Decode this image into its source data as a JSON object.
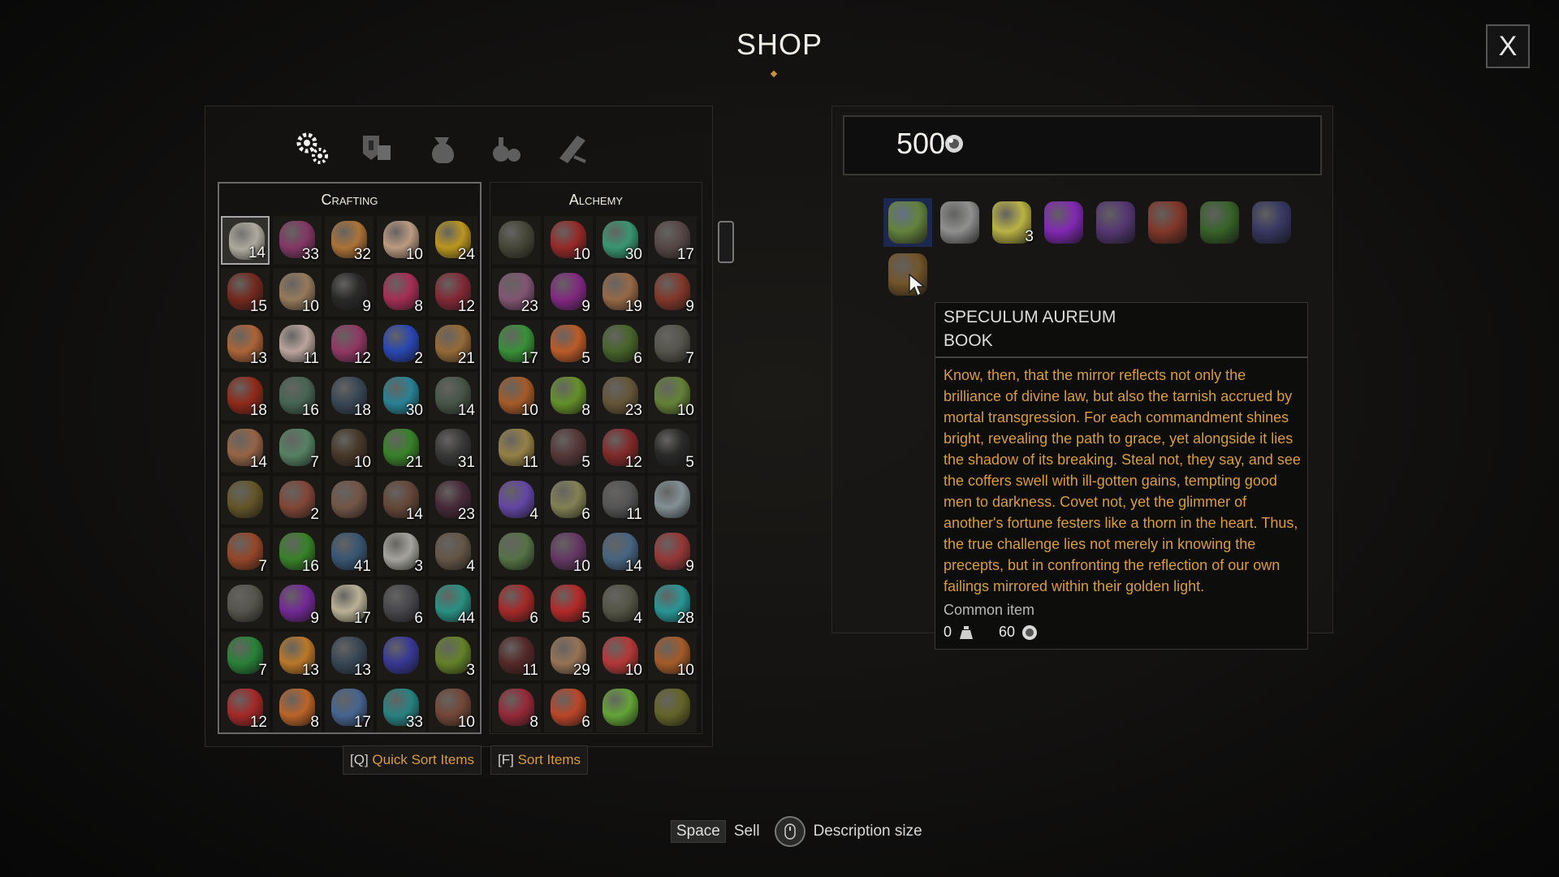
{
  "title": "SHOP",
  "close_label": "X",
  "tabs": [
    {
      "icon": "gears-icon",
      "active": true
    },
    {
      "icon": "armor-icon",
      "active": false
    },
    {
      "icon": "sack-icon",
      "active": false
    },
    {
      "icon": "potion-bottles-icon",
      "active": false
    },
    {
      "icon": "quest-scroll-icon",
      "active": false
    }
  ],
  "crafting": {
    "label": "Crafting",
    "items": [
      {
        "icon": "jar-icon",
        "qty": "14",
        "color": "#b8b4a8",
        "selected": true
      },
      {
        "icon": "fungus-icon",
        "qty": "33",
        "color": "#8a3a6a"
      },
      {
        "icon": "bark-icon",
        "qty": "32",
        "color": "#b87a3a"
      },
      {
        "icon": "vial-icon",
        "qty": "10",
        "color": "#c9a58a"
      },
      {
        "icon": "bottle-icon",
        "qty": "24",
        "color": "#c8a020"
      },
      {
        "icon": "claw-icon",
        "qty": "15",
        "color": "#7a2a1e"
      },
      {
        "icon": "sticks-icon",
        "qty": "10",
        "color": "#a08262"
      },
      {
        "icon": "horn-icon",
        "qty": "9",
        "color": "#2a2a2a"
      },
      {
        "icon": "eye-icon",
        "qty": "8",
        "color": "#b0305a"
      },
      {
        "icon": "tongue-icon",
        "qty": "12",
        "color": "#8a2a38"
      },
      {
        "icon": "brain-icon",
        "qty": "13",
        "color": "#b86a3a"
      },
      {
        "icon": "flask-icon",
        "qty": "11",
        "color": "#c8b0a8"
      },
      {
        "icon": "feather-icon",
        "qty": "12",
        "color": "#9a3a6a"
      },
      {
        "icon": "sapphire-icon",
        "qty": "2",
        "color": "#2a4ac0"
      },
      {
        "icon": "pouch-icon",
        "qty": "21",
        "color": "#a0703a"
      },
      {
        "icon": "red-potion-icon",
        "qty": "18",
        "color": "#9a2a1a"
      },
      {
        "icon": "leaves-icon",
        "qty": "16",
        "color": "#4a6a5a"
      },
      {
        "icon": "ore-icon",
        "qty": "18",
        "color": "#3a4a5a"
      },
      {
        "icon": "crystal-icon",
        "qty": "30",
        "color": "#2a8aa0"
      },
      {
        "icon": "wing-icon",
        "qty": "14",
        "color": "#4a5a4a"
      },
      {
        "icon": "egg-icon",
        "qty": "14",
        "color": "#a06a4a"
      },
      {
        "icon": "mandible-icon",
        "qty": "7",
        "color": "#5a8a6a"
      },
      {
        "icon": "spider-icon",
        "qty": "10",
        "color": "#4a3a2a"
      },
      {
        "icon": "coil-icon",
        "qty": "21",
        "color": "#3a8a2a"
      },
      {
        "icon": "claws-icon",
        "qty": "31",
        "color": "#3a3a3a"
      },
      {
        "icon": "insect-icon",
        "qty": "",
        "color": "#6a5a2a"
      },
      {
        "icon": "ear-icon",
        "qty": "2",
        "color": "#8a4a3a"
      },
      {
        "icon": "leather-icon",
        "qty": "",
        "color": "#7a5a4a"
      },
      {
        "icon": "ingot-icon",
        "qty": "14",
        "color": "#6a4a3a"
      },
      {
        "icon": "hair-icon",
        "qty": "23",
        "color": "#4a2a3a"
      },
      {
        "icon": "scales-icon",
        "qty": "7",
        "color": "#a04a2a"
      },
      {
        "icon": "green-bottle-icon",
        "qty": "16",
        "color": "#3a8a2a"
      },
      {
        "icon": "blue-shard-icon",
        "qty": "41",
        "color": "#3a5a7a"
      },
      {
        "icon": "silver-ingot-icon",
        "qty": "3",
        "color": "#b0b0a8"
      },
      {
        "icon": "iron-bar-icon",
        "qty": "4",
        "color": "#6a5a4a"
      },
      {
        "icon": "plate-icon",
        "qty": "",
        "color": "#5a5a50"
      },
      {
        "icon": "amethyst-icon",
        "qty": "9",
        "color": "#7a2aa0"
      },
      {
        "icon": "pearl-icon",
        "qty": "17",
        "color": "#c8bea0"
      },
      {
        "icon": "stone-icon",
        "qty": "6",
        "color": "#4a4a50"
      },
      {
        "icon": "teal-dust-icon",
        "qty": "44",
        "color": "#2a9a8a"
      },
      {
        "icon": "emerald-icon",
        "qty": "7",
        "color": "#2a8a3a"
      },
      {
        "icon": "amber-icon",
        "qty": "13",
        "color": "#c8802a"
      },
      {
        "icon": "black-pearl-icon",
        "qty": "13",
        "color": "#3a4a5a"
      },
      {
        "icon": "sapphire-dust-icon",
        "qty": "",
        "color": "#3a3aa0"
      },
      {
        "icon": "lizard-icon",
        "qty": "3",
        "color": "#6a8a2a"
      },
      {
        "icon": "ruby-icon",
        "qty": "12",
        "color": "#b02a2a"
      },
      {
        "icon": "topaz-icon",
        "qty": "8",
        "color": "#c86a2a"
      },
      {
        "icon": "diamond-icon",
        "qty": "17",
        "color": "#4a6a9a"
      },
      {
        "icon": "aquamarine-icon",
        "qty": "33",
        "color": "#2a8a8a"
      },
      {
        "icon": "planks-icon",
        "qty": "10",
        "color": "#7a4a3a"
      }
    ]
  },
  "alchemy": {
    "label": "Alchemy",
    "items": [
      {
        "icon": "toad-icon",
        "qty": "",
        "color": "#4a4a3a"
      },
      {
        "icon": "heart-icon",
        "qty": "10",
        "color": "#a02a2a"
      },
      {
        "icon": "green-flask-icon",
        "qty": "30",
        "color": "#3aa07a"
      },
      {
        "icon": "rock-icon",
        "qty": "17",
        "color": "#5a4a4a"
      },
      {
        "icon": "salt-icon",
        "qty": "23",
        "color": "#8a5a7a"
      },
      {
        "icon": "purple-flask-icon",
        "qty": "9",
        "color": "#8a2a8a"
      },
      {
        "icon": "teeth-icon",
        "qty": "19",
        "color": "#a0704a"
      },
      {
        "icon": "fang-icon",
        "qty": "9",
        "color": "#8a3a2a"
      },
      {
        "icon": "green-vial-icon",
        "qty": "17",
        "color": "#3a9a3a"
      },
      {
        "icon": "orange-resin-icon",
        "qty": "5",
        "color": "#c8602a"
      },
      {
        "icon": "herb-icon",
        "qty": "6",
        "color": "#4a6a2a"
      },
      {
        "icon": "ash-icon",
        "qty": "7",
        "color": "#5a5a50"
      },
      {
        "icon": "hand-icon",
        "qty": "10",
        "color": "#b0602a"
      },
      {
        "icon": "embryo-icon",
        "qty": "8",
        "color": "#6a9a2a"
      },
      {
        "icon": "root-icon",
        "qty": "23",
        "color": "#6a5a3a"
      },
      {
        "icon": "green-egg-icon",
        "qty": "10",
        "color": "#6a8a3a"
      },
      {
        "icon": "small-vial-icon",
        "qty": "11",
        "color": "#a08a4a"
      },
      {
        "icon": "orb-eye-icon",
        "qty": "5",
        "color": "#5a3a3a"
      },
      {
        "icon": "red-claw-icon",
        "qty": "12",
        "color": "#8a2a2a"
      },
      {
        "icon": "black-claw-icon",
        "qty": "5",
        "color": "#2a2a2a"
      },
      {
        "icon": "violet-flask-icon",
        "qty": "4",
        "color": "#6a4ab0"
      },
      {
        "icon": "speckled-egg-icon",
        "qty": "6",
        "color": "#8a8a5a"
      },
      {
        "icon": "grey-feathers-icon",
        "qty": "11",
        "color": "#5a5a5a"
      },
      {
        "icon": "quartz-icon",
        "qty": "",
        "color": "#8a9aa0"
      },
      {
        "icon": "moss-icon",
        "qty": "",
        "color": "#5a7a4a"
      },
      {
        "icon": "tentacle-icon",
        "qty": "10",
        "color": "#6a3a6a"
      },
      {
        "icon": "dagger-icon",
        "qty": "14",
        "color": "#4a6a8a"
      },
      {
        "icon": "meat-icon",
        "qty": "9",
        "color": "#a03a3a"
      },
      {
        "icon": "coral-icon",
        "qty": "6",
        "color": "#b02a2a"
      },
      {
        "icon": "red-tongue-icon",
        "qty": "5",
        "color": "#c02a2a"
      },
      {
        "icon": "skull-icon",
        "qty": "4",
        "color": "#5a5a4a"
      },
      {
        "icon": "cyan-flask-icon",
        "qty": "28",
        "color": "#2aa0a0"
      },
      {
        "icon": "twig-icon",
        "qty": "11",
        "color": "#5a2a2a"
      },
      {
        "icon": "tusk-icon",
        "qty": "29",
        "color": "#a07a5a"
      },
      {
        "icon": "fire-gem-icon",
        "qty": "10",
        "color": "#c03a3a"
      },
      {
        "icon": "amphora-icon",
        "qty": "10",
        "color": "#b0602a"
      },
      {
        "icon": "crimson-flask-icon",
        "qty": "8",
        "color": "#a02a3a"
      },
      {
        "icon": "red-mushroom-icon",
        "qty": "6",
        "color": "#c84a2a"
      },
      {
        "icon": "lime-flask-icon",
        "qty": "",
        "color": "#6ab03a"
      },
      {
        "icon": "shell-icon",
        "qty": "",
        "color": "#6a6a2a"
      }
    ]
  },
  "quick_sort": {
    "key": "[Q]",
    "label": "Quick Sort Items"
  },
  "sort": {
    "key": "[F]",
    "label": "Sort Items"
  },
  "money": "500",
  "shop_items": [
    {
      "icon": "salve-tin-icon",
      "qty": "",
      "color": "#6a8a3a",
      "highlight": true
    },
    {
      "icon": "amulet-icon",
      "qty": "",
      "color": "#9a9a9a"
    },
    {
      "icon": "potion-flask-icon",
      "qty": "3",
      "color": "#c8c04a"
    },
    {
      "icon": "violet-gem-icon",
      "qty": "",
      "color": "#8a2ac0"
    },
    {
      "icon": "purple-book-icon",
      "qty": "",
      "color": "#5a3a7a"
    },
    {
      "icon": "red-book-icon",
      "qty": "",
      "color": "#8a3a2a"
    },
    {
      "icon": "green-book-icon",
      "qty": "",
      "color": "#3a6a2a"
    },
    {
      "icon": "blue-book-icon",
      "qty": "",
      "color": "#3a3a6a"
    },
    {
      "icon": "brown-book-icon",
      "qty": "",
      "color": "#7a5a2a"
    }
  ],
  "tooltip": {
    "name": "SPECULUM AUREUM",
    "type": "BOOK",
    "description": "Know, then, that the mirror reflects not only the brilliance of divine law, but also the tarnish accrued by mortal transgression. For each commandment shines bright, revealing the path to grace, yet alongside it lies the shadow of its breaking. Steal not, they say, and see the coffers swell with ill-gotten gains, tempting good men to darkness. Covet not, yet the glimmer of another's fortune festers like a thorn in the heart. Thus, the true challenge lies not merely in knowing the precepts, but in confronting the reflection of our own failings mirrored within their golden light.",
    "rarity": "Common item",
    "weight": "0",
    "price": "60"
  },
  "hints": {
    "space_key": "Space",
    "space_action": "Sell",
    "mouse_action": "Description size"
  }
}
